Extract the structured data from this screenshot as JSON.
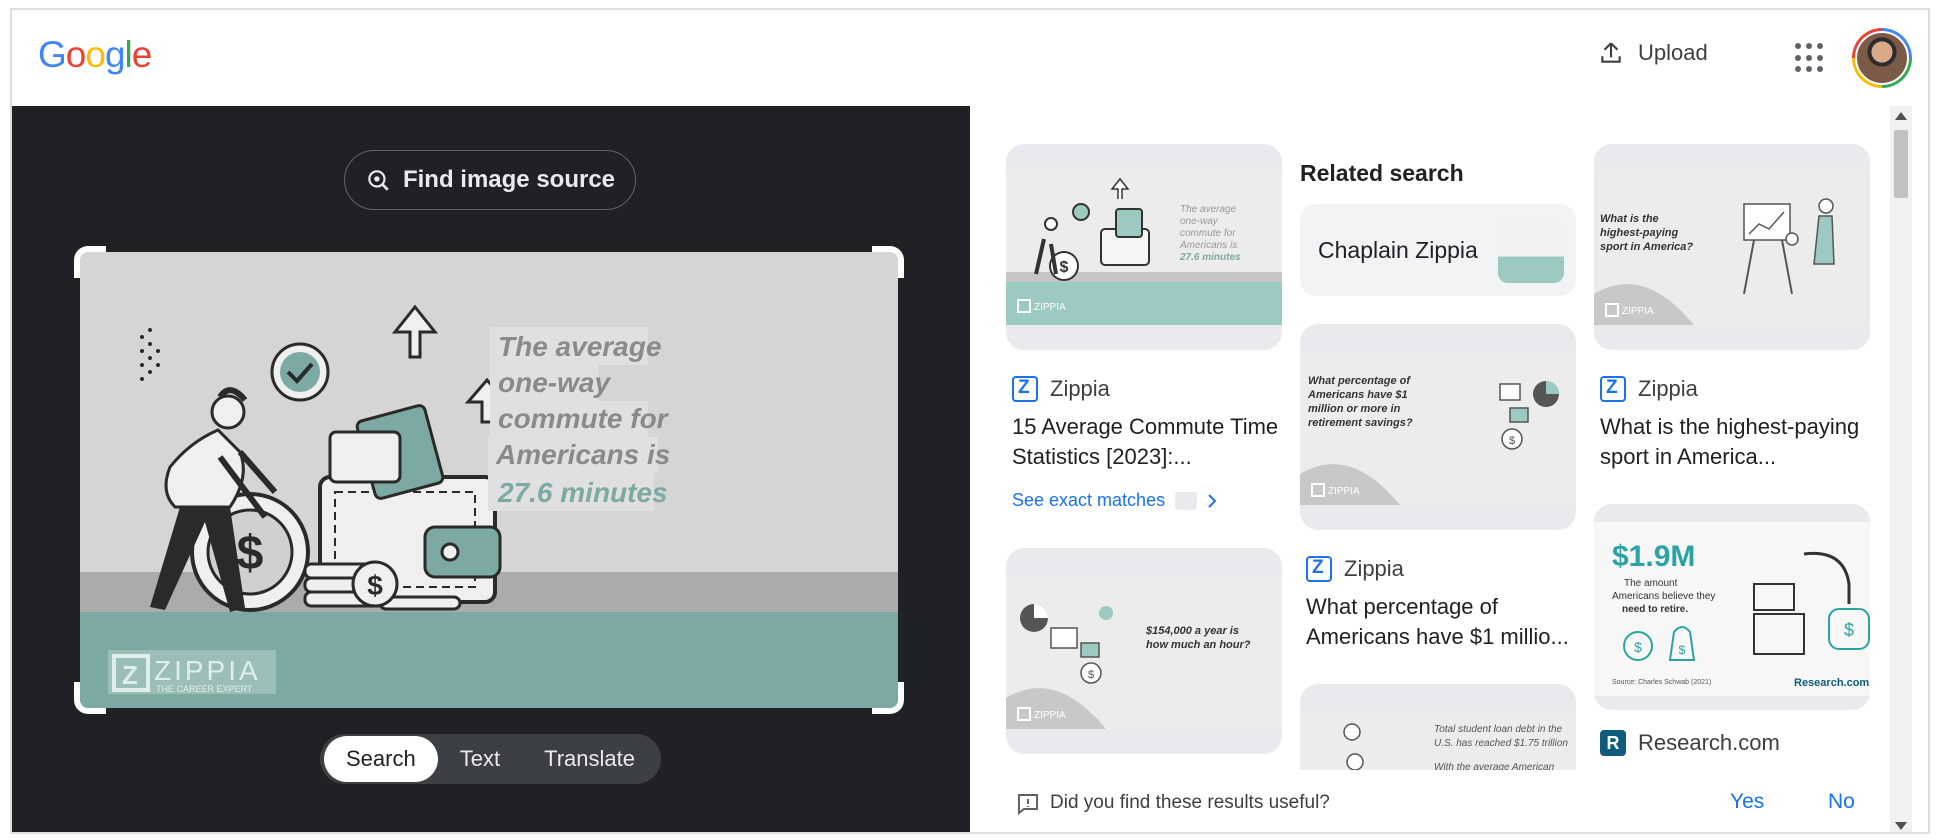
{
  "header": {
    "logo": [
      "G",
      "o",
      "o",
      "g",
      "l",
      "e"
    ],
    "logo_colors": [
      "#4285f4",
      "#ea4335",
      "#fbbc05",
      "#4285f4",
      "#34a853",
      "#ea4335"
    ],
    "upload_label": "Upload",
    "apps_icon": "apps-grid-icon",
    "avatar": "account-avatar"
  },
  "lens": {
    "find_source_label": "Find image source",
    "image_caption": {
      "lines": [
        "The average",
        "one-way",
        "commute for",
        "Americans is"
      ],
      "highlight": "27.6 minutes",
      "brand": "ZIPPIA",
      "tagline": "THE CAREER EXPERT"
    },
    "modes": [
      {
        "label": "Search",
        "active": true
      },
      {
        "label": "Text",
        "active": false
      },
      {
        "label": "Translate",
        "active": false
      }
    ]
  },
  "results": {
    "related_heading": "Related search",
    "related_chip": "Chaplain Zippia",
    "items": [
      {
        "source": "Zippia",
        "title": "15 Average Commute Time Statistics [2023]:...",
        "thumb_text": "The average one-way commute for Americans is 27.6 minutes",
        "exact_label": "See exact matches"
      },
      {
        "source": "Zippia",
        "title": "What percentage of Americans have $1 millio...",
        "thumb_text": "What percentage of Americans have $1 million or more in retirement savings?"
      },
      {
        "source": "Zippia",
        "title": "What is the highest-paying sport in America...",
        "thumb_text": "What is the highest-paying sport in America?"
      },
      {
        "source": "Research.com",
        "thumb_big": "$1.9M",
        "thumb_text": "The amount Americans believe they need to retire.",
        "thumb_source": "Source: Charles Schwab (2021)",
        "thumb_brand": "Research.com"
      },
      {
        "thumb_text": "$154,000 a year is how much an hour?"
      },
      {
        "thumb_text": "Total student loan debt in the U.S. has reached $1.75 trillion",
        "thumb_text2": "With the average American"
      }
    ],
    "brand_small": "ZIPPIA",
    "feedback": {
      "question": "Did you find these results useful?",
      "yes": "Yes",
      "no": "No"
    }
  },
  "colors": {
    "dark_bg": "#202124",
    "teal": "#7bb3ac",
    "link": "#1a73e8"
  }
}
